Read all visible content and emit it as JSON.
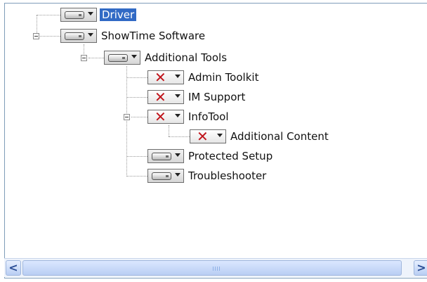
{
  "tree": {
    "items": [
      {
        "label": "Driver",
        "icon": "hard-drive-icon",
        "selected": true,
        "expander": "none"
      },
      {
        "label": "ShowTime Software",
        "icon": "hard-drive-icon",
        "selected": false,
        "expander": "minus"
      },
      {
        "label": "Additional Tools",
        "icon": "hard-drive-icon",
        "selected": false,
        "expander": "minus"
      },
      {
        "label": "Admin Toolkit",
        "icon": "red-x-icon",
        "selected": false,
        "expander": "none"
      },
      {
        "label": "IM Support",
        "icon": "red-x-icon",
        "selected": false,
        "expander": "none"
      },
      {
        "label": "InfoTool",
        "icon": "red-x-icon",
        "selected": false,
        "expander": "minus"
      },
      {
        "label": "Additional Content",
        "icon": "red-x-icon",
        "selected": false,
        "expander": "none"
      },
      {
        "label": "Protected Setup",
        "icon": "hard-drive-icon",
        "selected": false,
        "expander": "none"
      },
      {
        "label": "Troubleshooter",
        "icon": "hard-drive-icon",
        "selected": false,
        "expander": "none"
      }
    ]
  },
  "scrollbar": {
    "left_glyph": "<",
    "right_glyph": ">",
    "colors": {
      "track": "#eef3fb",
      "thumb": "#b9cef3",
      "arrow": "#2a4d95"
    }
  },
  "colors": {
    "selection": "#316ac5",
    "x_mark": "#c0141b",
    "border": "#7f9db9"
  }
}
